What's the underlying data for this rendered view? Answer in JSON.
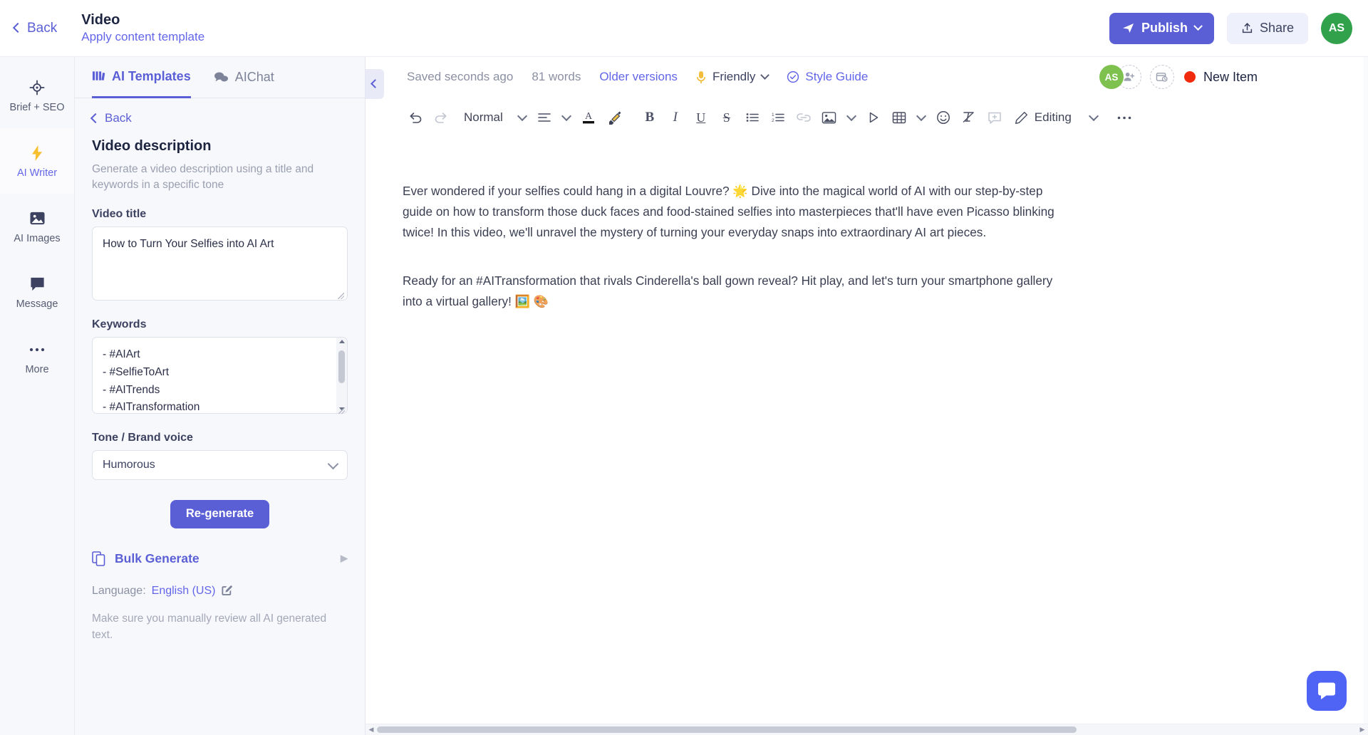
{
  "topbar": {
    "back_label": "Back",
    "title": "Video",
    "subtitle": "Apply content template",
    "publish_label": "Publish",
    "share_label": "Share",
    "avatar_initials": "AS"
  },
  "rail": {
    "items": [
      {
        "label": "Brief + SEO",
        "icon": "target-icon",
        "active": false
      },
      {
        "label": "AI Writer",
        "icon": "lightning-bolt-icon",
        "active": true
      },
      {
        "label": "AI Images",
        "icon": "image-icon",
        "active": false
      },
      {
        "label": "Message",
        "icon": "chat-bubble-icon",
        "active": false
      },
      {
        "label": "More",
        "icon": "ellipsis-icon",
        "active": false
      }
    ]
  },
  "panel": {
    "tabs": [
      {
        "label": "AI Templates",
        "icon": "templates-grid-icon",
        "active": true
      },
      {
        "label": "AIChat",
        "icon": "chat-bubbles-icon",
        "active": false
      }
    ],
    "back_label": "Back",
    "template_title": "Video description",
    "template_description": "Generate a video description using a title and keywords in a specific tone",
    "video_title_label": "Video title",
    "video_title_value": "How to Turn Your Selfies into AI Art",
    "keywords_label": "Keywords",
    "keywords_value": "- #AIArt\n- #SelfieToArt\n- #AITrends\n- #AITransformation",
    "tone_label": "Tone / Brand voice",
    "tone_value": "Humorous",
    "regenerate_label": "Re-generate",
    "bulk_generate_label": "Bulk Generate",
    "language_prefix": "Language:",
    "language_value": "English (US)",
    "disclaimer": "Make sure you manually review all AI generated text."
  },
  "editor": {
    "status": {
      "saved": "Saved seconds ago",
      "words": "81 words",
      "older_versions": "Older versions",
      "tone": "Friendly",
      "style_guide": "Style Guide",
      "avatar_initials": "AS",
      "new_item": "New Item"
    },
    "toolbar": {
      "undo": "undo-icon",
      "redo": "redo-icon",
      "paragraph_style": "Normal",
      "align": "align-icon",
      "text_color": "text-color-icon",
      "highlight": "highlight-icon",
      "bold": "B",
      "italic": "I",
      "underline": "U",
      "strikethrough": "S",
      "bullet_list": "bullet-list-icon",
      "numbered_list": "numbered-list-icon",
      "link": "link-icon",
      "image": "image-icon",
      "video": "play-icon",
      "table": "table-icon",
      "emoji": "emoji-icon",
      "clear_format": "clear-format-icon",
      "comment": "comment-icon",
      "mode_label": "Editing",
      "more": "ellipsis-icon"
    },
    "document": {
      "paragraphs": [
        "Ever wondered if your selfies could hang in a digital Louvre? 🌟 Dive into the magical world of AI with our step-by-step guide on how to transform those duck faces and food-stained selfies into masterpieces that'll have even Picasso blinking twice! In this video, we'll unravel the mystery of turning your everyday snaps into extraordinary AI art pieces.",
        "Ready for an #AITransformation that rivals Cinderella's ball gown reveal? Hit play, and let's turn your smartphone gallery into a virtual gallery! 🖼️ 🎨"
      ]
    }
  },
  "colors": {
    "accent": "#5b5fd6",
    "link": "#6366e8",
    "avatar_top": "#31a14b",
    "avatar_editor": "#7ec14f",
    "status_dot": "#f02a0d",
    "chat_fab": "#4f64f5"
  }
}
